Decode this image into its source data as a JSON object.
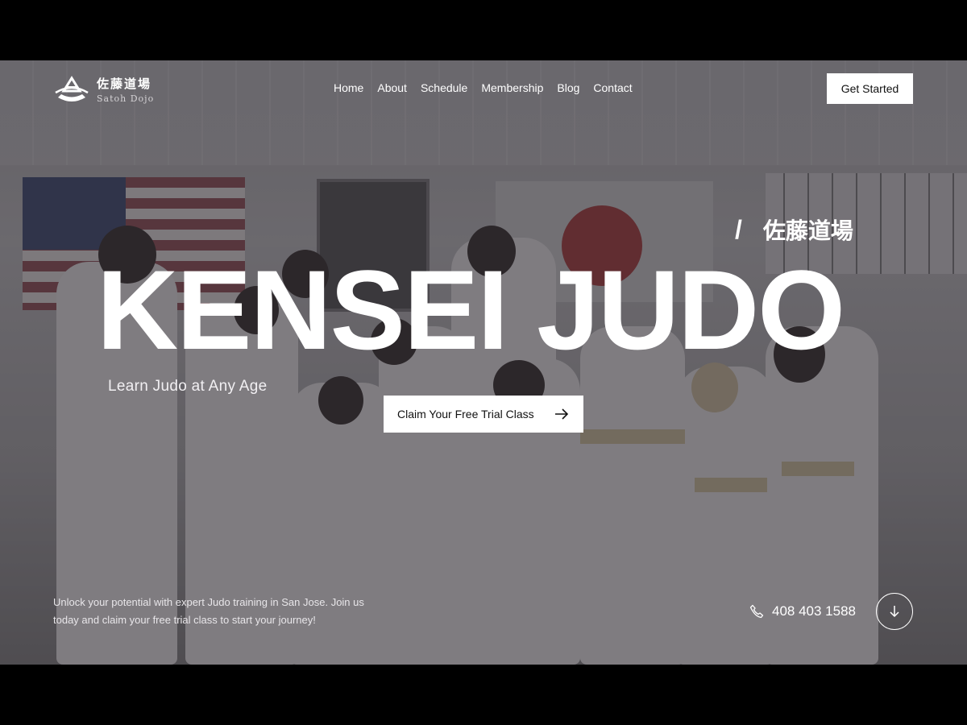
{
  "brand": {
    "name_jp": "佐藤道場",
    "name_en": "Satoh Dojo"
  },
  "nav": {
    "items": [
      "Home",
      "About",
      "Schedule",
      "Membership",
      "Blog",
      "Contact"
    ]
  },
  "header": {
    "cta_label": "Get Started"
  },
  "hero": {
    "jp_tag": "佐藤道場",
    "slash": "/",
    "title": "KENSEI JUDO",
    "subtitle": "Learn Judo at Any Age",
    "cta_label": "Claim Your Free Trial Class",
    "blurb": "Unlock your potential with expert Judo training in San Jose. Join us today and claim your free trial class to start your journey!",
    "phone": "408 403 1588",
    "icons": {
      "cta": "arrow-right-icon",
      "phone": "phone-icon",
      "scroll": "arrow-down-icon",
      "logo": "dojo-logo-icon"
    },
    "colors": {
      "accent": "#9a2a22",
      "button_bg": "#ffffff",
      "text": "#ffffff"
    }
  }
}
